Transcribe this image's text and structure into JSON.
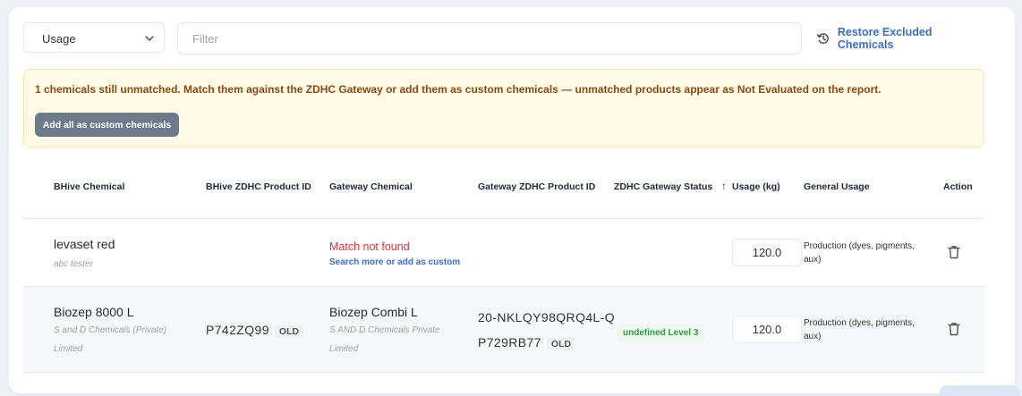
{
  "toolbar": {
    "usage_select": "Usage",
    "filter_placeholder": "Filter",
    "restore_label": "Restore Excluded Chemicals"
  },
  "warning": {
    "message": "1 chemicals still unmatched. Match them against the ZDHC Gateway or add them as custom chemicals — unmatched products appear as Not Evaluated on the report.",
    "button_label": "Add all as custom chemicals"
  },
  "table": {
    "headers": {
      "bhive_chemical": "BHive Chemical",
      "bhive_zdhc_id": "BHive ZDHC Product ID",
      "gateway_chemical": "Gateway Chemical",
      "gateway_zdhc_id": "Gateway ZDHC Product ID",
      "zdhc_status": "ZDHC Gateway Status",
      "usage_sort_arrow": "↑",
      "usage": "Usage (kg)",
      "general_usage": "General Usage",
      "action": "Action"
    },
    "rows": [
      {
        "bhive_name": "levaset red",
        "bhive_supplier": "abc tester",
        "bhive_zdhc_id": "",
        "gateway_status_text": "Match not found",
        "gateway_link": "Search more or add as custom",
        "usage": "120.0",
        "general_usage": "Production (dyes, pigments, aux)"
      },
      {
        "bhive_name": "Biozep 8000 L",
        "bhive_supplier": "S and D Chemicals (Private) Limited",
        "bhive_zdhc_id": "P742ZQ99",
        "bhive_id_badge": "OLD",
        "gateway_name": "Biozep Combi L",
        "gateway_supplier": "S AND D Chemicals Private Limited",
        "gateway_zdhc_id_line1": "20-NKLQY98QRQ4L-Q",
        "gateway_zdhc_id_line2": "P729RB77",
        "gateway_id_badge": "OLD",
        "zdhc_status": "undefined Level 3",
        "usage": "120.0",
        "general_usage": "Production (dyes, pigments, aux)"
      }
    ]
  },
  "colors": {
    "accent": "#3b6fc4",
    "warning_bg": "#fffbe6",
    "warning_text": "#8a4a12",
    "error": "#d93636",
    "success": "#2f9e44"
  },
  "icons": {
    "select_chevron": "chevron-down-icon",
    "restore": "history-icon",
    "delete": "trash-icon"
  }
}
